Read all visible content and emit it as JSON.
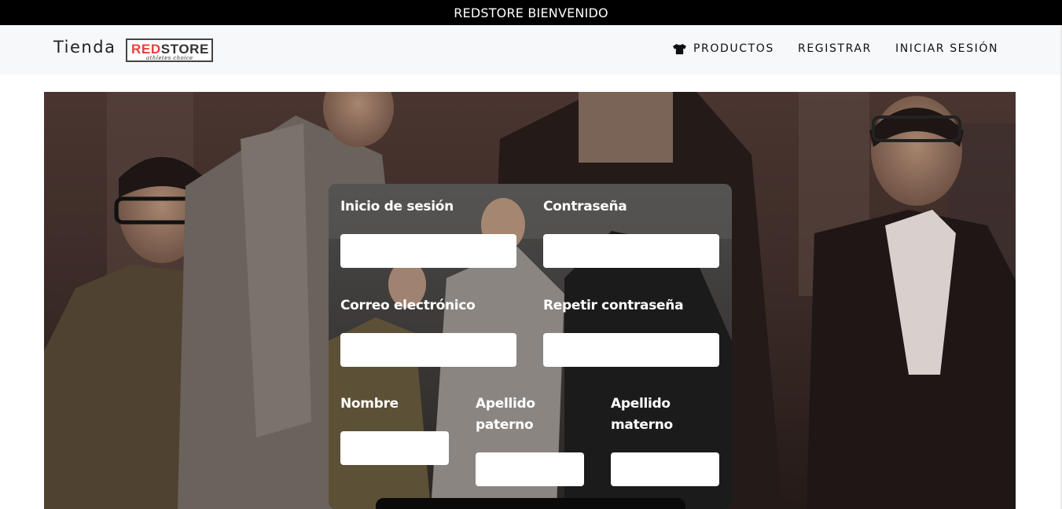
{
  "topbar": {
    "text": "REDSTORE BIENVENIDO"
  },
  "navbar": {
    "brand": "Tienda",
    "logo": {
      "part_red": "RED",
      "part_dark": "STORE",
      "tagline": "athletes choice"
    },
    "items": [
      {
        "label": "PRODUCTOS",
        "icon": "t-shirt-icon"
      },
      {
        "label": "REGISTRAR"
      },
      {
        "label": "INICIAR SESIÓN"
      }
    ]
  },
  "form": {
    "username_label": "Inicio de sesión",
    "password_label": "Contraseña",
    "email_label": "Correo electrónico",
    "repeat_password_label": "Repetir contraseña",
    "name_label": "Nombre",
    "paternal_label_1": "Apellido",
    "paternal_label_2": "paterno",
    "maternal_label_1": "Apellido",
    "maternal_label_2": "materno",
    "username_value": "",
    "password_value": "",
    "email_value": "",
    "repeat_password_value": "",
    "name_value": "",
    "paternal_value": "",
    "maternal_value": ""
  },
  "colors": {
    "topbar": "#000000",
    "navbar": "#f6f8fa",
    "logo_red": "#e8403d",
    "label": "#ffffff"
  }
}
